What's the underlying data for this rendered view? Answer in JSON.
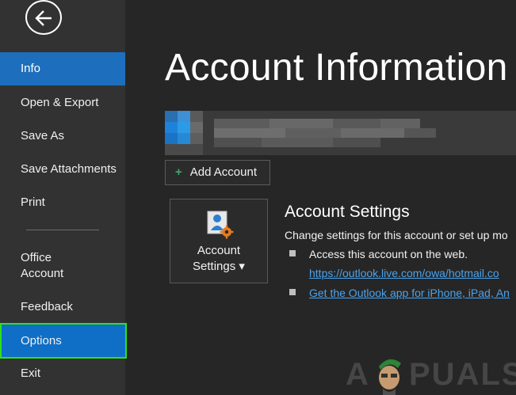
{
  "sidebar": {
    "back_label": "Back",
    "items": [
      {
        "label": "Info"
      },
      {
        "label": "Open & Export"
      },
      {
        "label": "Save As"
      },
      {
        "label": "Save Attachments"
      },
      {
        "label": "Print"
      },
      {
        "label_line1": "Office",
        "label_line2": "Account"
      },
      {
        "label": "Feedback"
      },
      {
        "label": "Options"
      },
      {
        "label": "Exit"
      }
    ]
  },
  "main": {
    "title": "Account Information",
    "add_account_label": "Add Account",
    "settings_tile": {
      "line1": "Account",
      "line2": "Settings ▾"
    },
    "section": {
      "heading": "Account Settings",
      "description": "Change settings for this account or set up mo",
      "bullet1": "Access this account on the web.",
      "link1": "https://outlook.live.com/owa/hotmail.co",
      "link2": "Get the Outlook app for iPhone, iPad, An"
    }
  },
  "watermark": {
    "letter_a": "A",
    "rest": "PUALS"
  },
  "colors": {
    "sidebar_bg": "#323232",
    "main_bg": "#262626",
    "selected": "#1d6fbd",
    "highlight_outline": "#2fe01a",
    "link": "#4aa3ee"
  }
}
